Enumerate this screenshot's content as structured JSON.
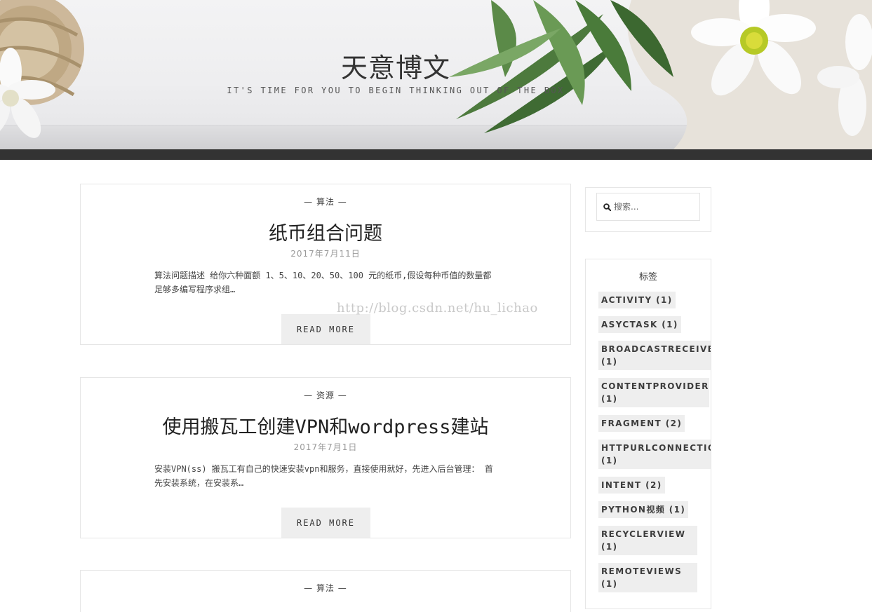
{
  "site": {
    "title": "天意博文",
    "tagline": "IT'S TIME FOR YOU TO BEGIN THINKING OUT OF THE BOX"
  },
  "watermark": "http://blog.csdn.net/hu_lichao",
  "posts": [
    {
      "category": "— 算法 —",
      "title": "纸币组合问题",
      "date": "2017年7月11日",
      "excerpt": "算法问题描述 给你六种面额 1、5、10、20、50、100 元的纸币,假设每种币值的数量都足够多编写程序求组…",
      "read_more": "READ MORE"
    },
    {
      "category": "— 资源 —",
      "title": "使用搬瓦工创建VPN和wordpress建站",
      "date": "2017年7月1日",
      "excerpt": "安装VPN(ss) 搬瓦工有自己的快速安装vpn和服务，直接使用就好，先进入后台管理： 首先安装系统，在安装系…",
      "read_more": "READ MORE"
    },
    {
      "category": "— 算法 —"
    }
  ],
  "sidebar": {
    "search_placeholder": "搜索...",
    "tags_title": "标签",
    "tags": [
      {
        "name": "ACTIVITY",
        "count": "(1)"
      },
      {
        "name": "ASYCTASK",
        "count": "(1)"
      },
      {
        "name": "BROADCASTRECEIVE",
        "count": "(1)"
      },
      {
        "name": "CONTENTPROVIDER",
        "count": "(1)"
      },
      {
        "name": "FRAGMENT",
        "count": "(2)"
      },
      {
        "name": "HTTPURLCONNECTIO",
        "count": "(1)"
      },
      {
        "name": "INTENT",
        "count": "(2)"
      },
      {
        "name": "PYTHON视频",
        "count": "(1)"
      },
      {
        "name": "RECYCLERVIEW",
        "count": "(1)"
      },
      {
        "name": "REMOTEVIEWS",
        "count": "(1)"
      }
    ]
  },
  "colors": {
    "nav_bar": "#333333",
    "tag_bg": "#eeeeee",
    "border": "#e6e6e6"
  }
}
